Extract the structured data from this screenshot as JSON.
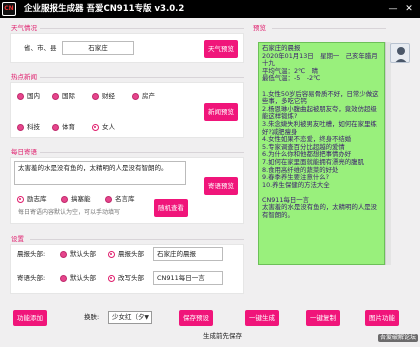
{
  "title_bar": {
    "logo_text": "CN",
    "title": "企业服报生成器   吾爱CN911专版 v3.0.2",
    "minimize_glyph": "—",
    "close_glyph": "✕"
  },
  "weather": {
    "group_label": "天气情况",
    "location_label": "省、市、县",
    "location_value": "石家庄",
    "button_label": "天气预览"
  },
  "news": {
    "group_label": "热点新闻",
    "categories": [
      {
        "label": "国内",
        "selected": false
      },
      {
        "label": "国际",
        "selected": false
      },
      {
        "label": "财经",
        "selected": false
      },
      {
        "label": "房产",
        "selected": false
      },
      {
        "label": "科技",
        "selected": false
      },
      {
        "label": "体育",
        "selected": false
      },
      {
        "label": "女人",
        "selected": true
      }
    ],
    "button_label": "新闻预览"
  },
  "quote": {
    "group_label": "每日寄语",
    "text": "太害羞的水是没有鱼的，太精明的人是没有智朗的。",
    "sources": [
      {
        "label": "励志库",
        "selected": true
      },
      {
        "label": "搞塞能",
        "selected": false
      },
      {
        "label": "名言库",
        "selected": false
      }
    ],
    "placeholder": "每日寄语内容默认为空，可以手动填写",
    "preview_button": "寄语预览",
    "random_button": "随机查看"
  },
  "settings": {
    "group_label": "设置",
    "morning_header": {
      "label": "晨报头部:",
      "options": [
        {
          "label": "默认头部",
          "selected": false
        },
        {
          "label": "晨报头部",
          "selected": true
        }
      ],
      "value": "石家庄的晨报"
    },
    "quote_header": {
      "label": "寄语头部:",
      "options": [
        {
          "label": "默认头部",
          "selected": false
        },
        {
          "label": "改写头部",
          "selected": true
        }
      ],
      "value": "CN911每日一言"
    }
  },
  "preview": {
    "group_label": "预览",
    "lines": [
      "石家庄的晨报",
      "2020年01月13日　星期一　己亥年腊月十九",
      "平均气温：2℃　晴",
      "最低气温：-5　-2℃",
      "",
      "1.女性50岁后容易骨质不好，日常少做这些事，多吃它钙",
      "2.杨恩琳小腹曲起被朋友夸，竟效仿超级能这样锻炼?",
      "3.朱念婕失利被男友吐槽，如何在家里练好?减肥瘦身",
      "4.女性如果不恋爱，终身不结婚",
      "5.专家调查百分比超越的爱情",
      "6.为什么你和他都想把事情办好",
      "7.如何在家里面就能拥有漂亮的腹肌",
      "8.食用高纤维的蔬菜的好处",
      "9.春季养生要注意什么?",
      "10.养生保健的方法大全",
      "",
      "CN911每日一言",
      "太害羞的水是没有鱼的，太精明的人是没有智朗的。"
    ]
  },
  "toolbar": {
    "function_add": "功能添加",
    "voice_label": "换肤:",
    "voice_value": "少女红（夕",
    "save_settings": "保存预设",
    "generate": "一键生成",
    "copy": "一键复制",
    "image_function": "图片功能",
    "status": "生成前先保存"
  },
  "watermark": "吾爱破解论坛"
}
